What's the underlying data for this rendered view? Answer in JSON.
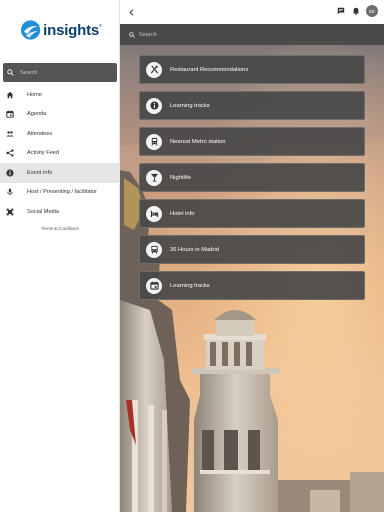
{
  "brand": {
    "name": "insights",
    "tm": "®",
    "color": "#0d3f6e"
  },
  "sidebar": {
    "search_placeholder": "Search",
    "items": [
      {
        "label": "Home",
        "icon": "home-icon",
        "active": false
      },
      {
        "label": "Agenda",
        "icon": "calendar-icon",
        "active": false
      },
      {
        "label": "Attendees",
        "icon": "people-icon",
        "active": false
      },
      {
        "label": "Activity Feed",
        "icon": "share-icon",
        "active": false
      },
      {
        "label": "Event Info",
        "icon": "info-icon",
        "active": true
      },
      {
        "label": "Host / Presenting / facilitator",
        "icon": "microphone-icon",
        "active": false
      },
      {
        "label": "Social Media",
        "icon": "social-icon",
        "active": false
      }
    ],
    "terms": "Terms & Conditions"
  },
  "topbar": {
    "avatar_initials": "EE",
    "icons": [
      "chat-icon",
      "bell-icon"
    ]
  },
  "main": {
    "search_placeholder": "Search",
    "tiles": [
      {
        "label": "Restaurant Recommendations",
        "icon": "restaurant-icon"
      },
      {
        "label": "Learning tracks",
        "icon": "info-icon"
      },
      {
        "label": "Nearest Metro station",
        "icon": "train-icon"
      },
      {
        "label": "Nightlife",
        "icon": "cocktail-icon"
      },
      {
        "label": "Hotel info",
        "icon": "hotel-icon"
      },
      {
        "label": "36 Hours in Madrid",
        "icon": "bus-icon"
      },
      {
        "label": "Learning tracks",
        "icon": "calendar-icon"
      }
    ]
  },
  "colors": {
    "tile_bg": "#484848",
    "sidebar_active": "#e6e6e6",
    "search_bg": "#555555"
  }
}
